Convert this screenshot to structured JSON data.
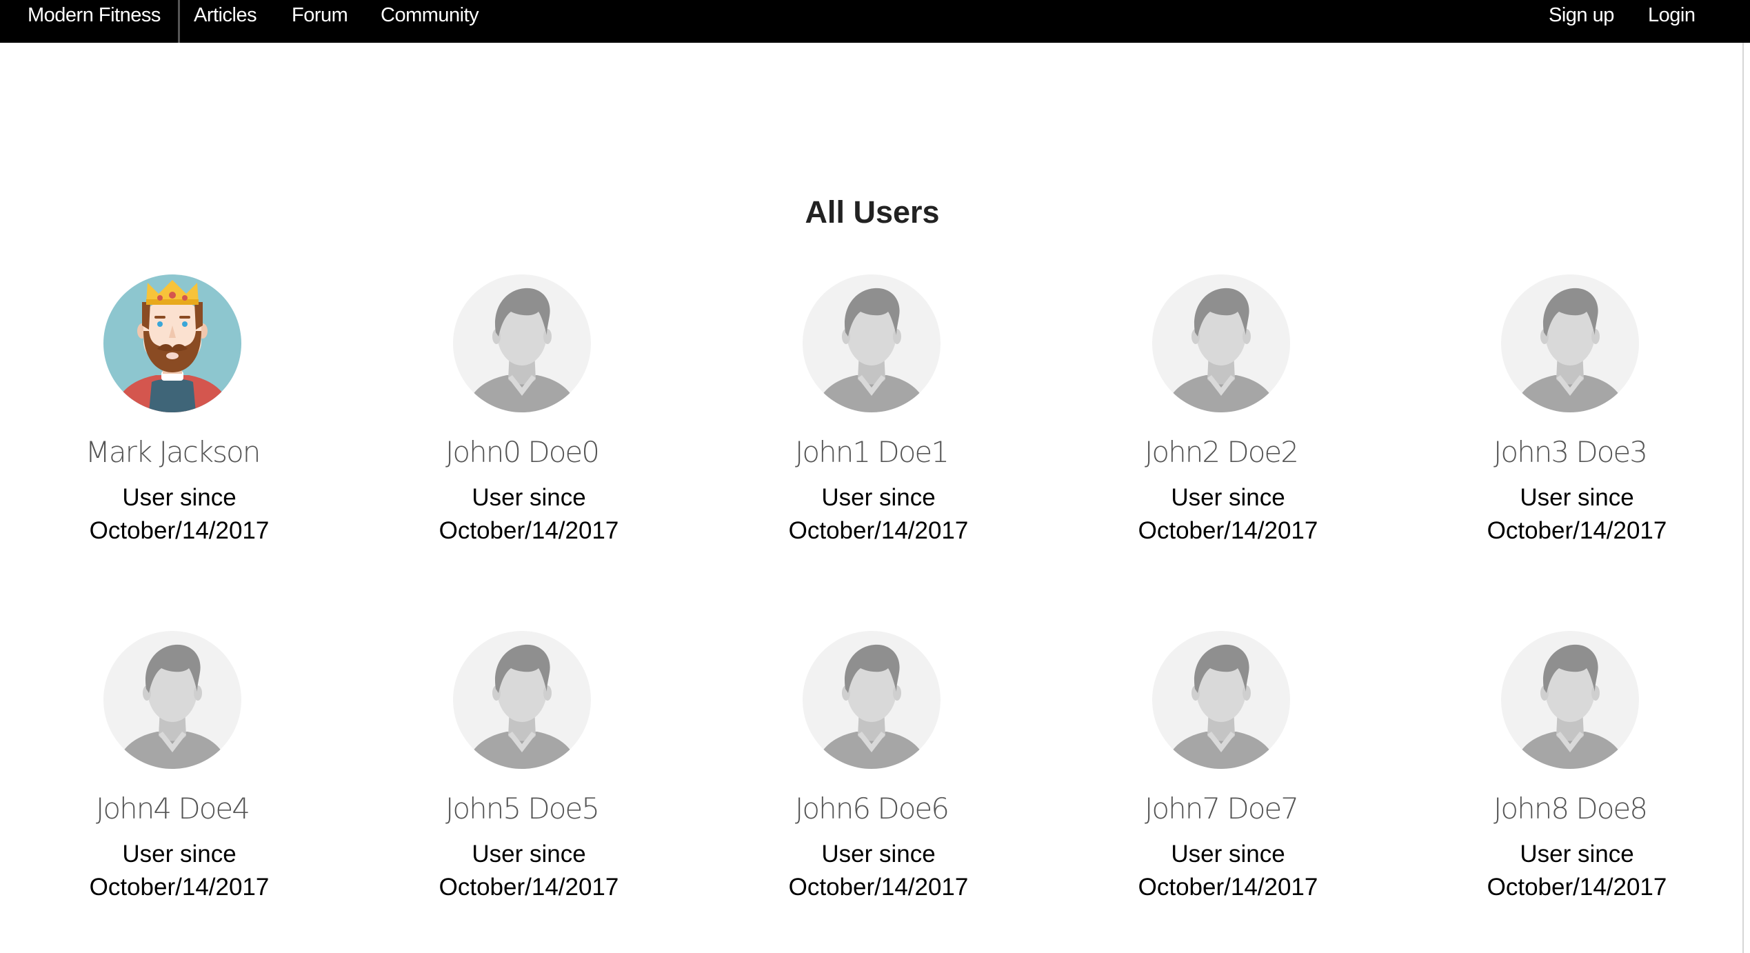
{
  "nav": {
    "brand": "Modern Fitness",
    "links": [
      "Articles",
      "Forum",
      "Community"
    ],
    "signup": "Sign up",
    "login": "Login"
  },
  "page_title": "All Users",
  "users": [
    {
      "name": "Mark Jackson",
      "since_label": "User since",
      "since_date": "October/14/2017",
      "avatar": "king-avatar-icon"
    },
    {
      "name": "John0 Doe0",
      "since_label": "User since",
      "since_date": "October/14/2017",
      "avatar": "default-user-avatar-icon"
    },
    {
      "name": "John1 Doe1",
      "since_label": "User since",
      "since_date": "October/14/2017",
      "avatar": "default-user-avatar-icon"
    },
    {
      "name": "John2 Doe2",
      "since_label": "User since",
      "since_date": "October/14/2017",
      "avatar": "default-user-avatar-icon"
    },
    {
      "name": "John3 Doe3",
      "since_label": "User since",
      "since_date": "October/14/2017",
      "avatar": "default-user-avatar-icon"
    },
    {
      "name": "John4 Doe4",
      "since_label": "User since",
      "since_date": "October/14/2017",
      "avatar": "default-user-avatar-icon"
    },
    {
      "name": "John5 Doe5",
      "since_label": "User since",
      "since_date": "October/14/2017",
      "avatar": "default-user-avatar-icon"
    },
    {
      "name": "John6 Doe6",
      "since_label": "User since",
      "since_date": "October/14/2017",
      "avatar": "default-user-avatar-icon"
    },
    {
      "name": "John7 Doe7",
      "since_label": "User since",
      "since_date": "October/14/2017",
      "avatar": "default-user-avatar-icon"
    },
    {
      "name": "John8 Doe8",
      "since_label": "User since",
      "since_date": "October/14/2017",
      "avatar": "default-user-avatar-icon"
    }
  ],
  "colors": {
    "navbar_bg": "#000000",
    "nav_text": "#ffffff",
    "avatar_bg_default": "#f2f2f2",
    "avatar_figure": "#a6a6a6",
    "avatar_bg_king": "#8dc6cf",
    "name_text": "#555555"
  }
}
